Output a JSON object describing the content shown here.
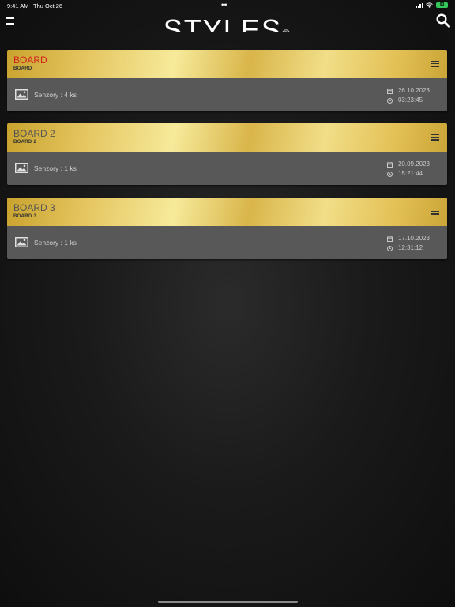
{
  "status": {
    "time": "9:41 AM",
    "date": "Thu Oct 26",
    "battery": "93"
  },
  "header": {
    "logo": "STYLES",
    "reg": "®"
  },
  "boards": [
    {
      "title": "BOARD",
      "subtitle": "BOARD",
      "sensors": "Senzory : 4 ks",
      "date": "26.10.2023",
      "time": "03:23:45",
      "title_color": "#d0201b"
    },
    {
      "title": "BOARD 2",
      "subtitle": "BOARD 2",
      "sensors": "Senzory : 1 ks",
      "date": "20.09.2023",
      "time": "15:21:44"
    },
    {
      "title": "BOARD 3",
      "subtitle": "BOARD 3",
      "sensors": "Senzory : 1 ks",
      "date": "17.10.2023",
      "time": "12:31:12"
    }
  ],
  "colors": {
    "accent_gold": "#e5c560",
    "card_body": "#585858",
    "title_red": "#d0201b"
  }
}
